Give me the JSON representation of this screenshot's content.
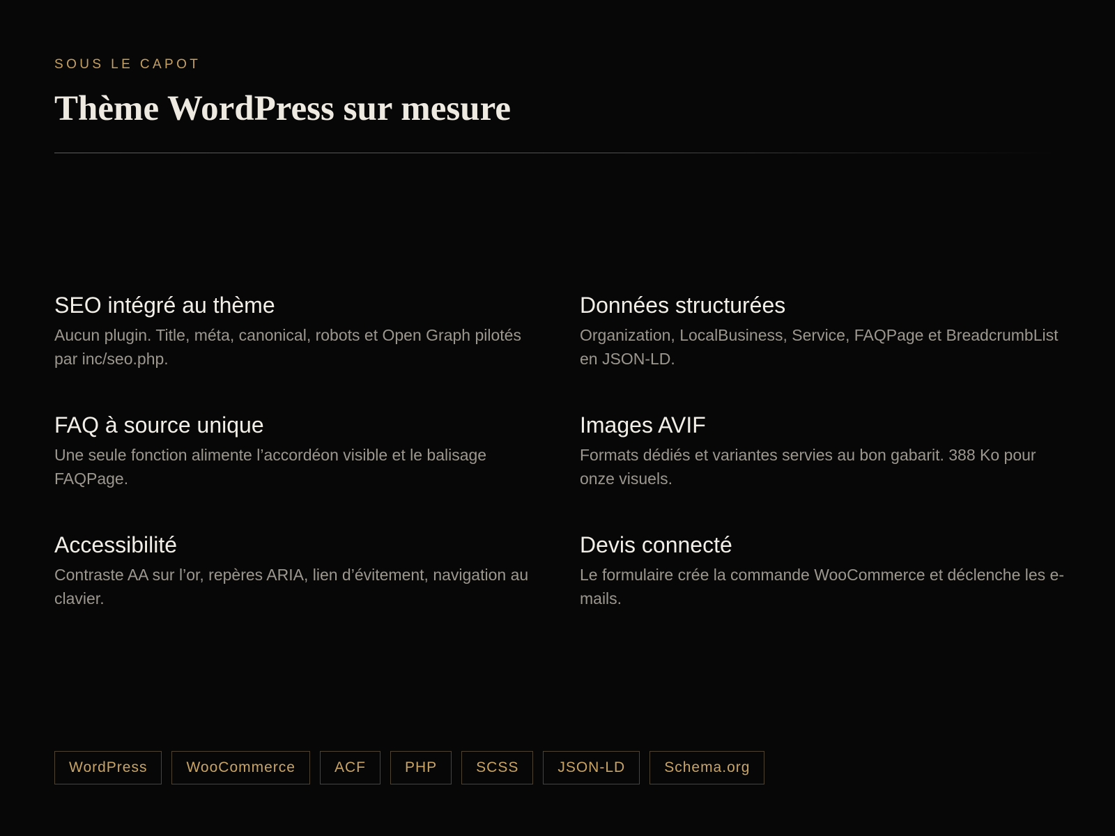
{
  "header": {
    "eyebrow": "SOUS LE CAPOT",
    "title": "Thème WordPress sur mesure"
  },
  "features": [
    {
      "title": "SEO intégré au thème",
      "text": "Aucun plugin. Title, méta, canonical, robots et Open Graph pilotés par inc/seo.php."
    },
    {
      "title": "Données structurées",
      "text": "Organization, LocalBusiness, Service, FAQPage et BreadcrumbList en JSON-LD."
    },
    {
      "title": "FAQ à source unique",
      "text": "Une seule fonction alimente l’accordéon visible et le balisage FAQPage."
    },
    {
      "title": "Images AVIF",
      "text": "Formats dédiés et variantes servies au bon gabarit. 388 Ko pour onze visuels."
    },
    {
      "title": "Accessibilité",
      "text": "Contraste AA sur l’or, repères ARIA, lien d’évitement, navigation au clavier."
    },
    {
      "title": "Devis connecté",
      "text": "Le formulaire crée la commande WooCommerce et déclenche les e-mails."
    }
  ],
  "tags": [
    "WordPress",
    "WooCommerce",
    "ACF",
    "PHP",
    "SCSS",
    "JSON-LD",
    "Schema.org"
  ],
  "colors": {
    "background": "#070707",
    "accent_gold": "#c5a063",
    "heading": "#eeeae2",
    "body_text": "#9c978f",
    "tag_border": "#4d4330"
  }
}
